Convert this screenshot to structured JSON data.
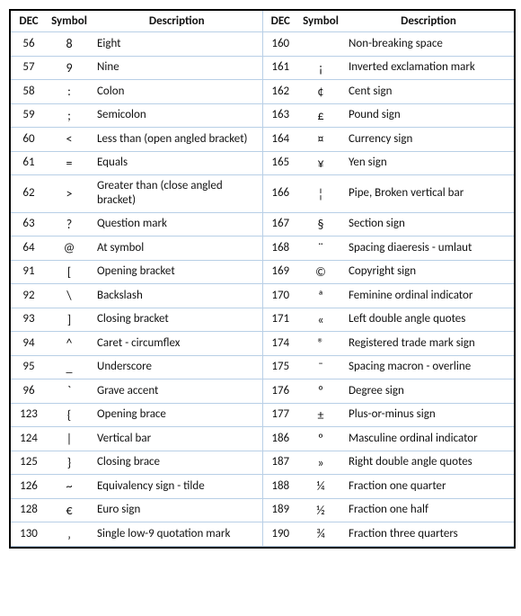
{
  "headers": {
    "dec": "DEC",
    "symbol": "Symbol",
    "description": "Description"
  },
  "rows": [
    {
      "l": {
        "dec": "56",
        "sym": "8",
        "desc": "Eight"
      },
      "r": {
        "dec": "160",
        "sym": "",
        "desc": "Non-breaking space"
      }
    },
    {
      "l": {
        "dec": "57",
        "sym": "9",
        "desc": "Nine"
      },
      "r": {
        "dec": "161",
        "sym": "¡",
        "desc": "Inverted exclamation mark"
      }
    },
    {
      "l": {
        "dec": "58",
        "sym": ":",
        "desc": "Colon"
      },
      "r": {
        "dec": "162",
        "sym": "¢",
        "desc": "Cent sign"
      }
    },
    {
      "l": {
        "dec": "59",
        "sym": ";",
        "desc": "Semicolon"
      },
      "r": {
        "dec": "163",
        "sym": "£",
        "desc": "Pound sign"
      }
    },
    {
      "l": {
        "dec": "60",
        "sym": "<",
        "desc": "Less than (open angled bracket)"
      },
      "r": {
        "dec": "164",
        "sym": "¤",
        "desc": "Currency sign"
      }
    },
    {
      "l": {
        "dec": "61",
        "sym": "=",
        "desc": "Equals"
      },
      "r": {
        "dec": "165",
        "sym": "¥",
        "desc": "Yen sign"
      }
    },
    {
      "l": {
        "dec": "62",
        "sym": ">",
        "desc": "Greater than (close angled bracket)"
      },
      "r": {
        "dec": "166",
        "sym": "¦",
        "desc": "Pipe, Broken vertical bar"
      }
    },
    {
      "l": {
        "dec": "63",
        "sym": "?",
        "desc": "Question mark"
      },
      "r": {
        "dec": "167",
        "sym": "§",
        "desc": "Section sign"
      }
    },
    {
      "l": {
        "dec": "64",
        "sym": "@",
        "desc": "At symbol"
      },
      "r": {
        "dec": "168",
        "sym": "¨",
        "desc": "Spacing diaeresis - umlaut"
      }
    },
    {
      "l": {
        "dec": "91",
        "sym": "[",
        "desc": "Opening bracket"
      },
      "r": {
        "dec": "169",
        "sym": "©",
        "desc": "Copyright sign"
      }
    },
    {
      "l": {
        "dec": "92",
        "sym": "\\",
        "desc": "Backslash"
      },
      "r": {
        "dec": "170",
        "sym": "ª",
        "desc": "Feminine ordinal indicator"
      }
    },
    {
      "l": {
        "dec": "93",
        "sym": "]",
        "desc": "Closing bracket"
      },
      "r": {
        "dec": "171",
        "sym": "«",
        "desc": "Left double angle quotes"
      }
    },
    {
      "l": {
        "dec": "94",
        "sym": "^",
        "desc": "Caret - circumflex"
      },
      "r": {
        "dec": "174",
        "sym": "®",
        "desc": "Registered trade mark sign"
      }
    },
    {
      "l": {
        "dec": "95",
        "sym": "_",
        "desc": "Underscore"
      },
      "r": {
        "dec": "175",
        "sym": "¯",
        "desc": "Spacing macron - overline"
      }
    },
    {
      "l": {
        "dec": "96",
        "sym": "`",
        "desc": "Grave accent"
      },
      "r": {
        "dec": "176",
        "sym": "°",
        "desc": "Degree sign"
      }
    },
    {
      "l": {
        "dec": "123",
        "sym": "{",
        "desc": "Opening brace"
      },
      "r": {
        "dec": "177",
        "sym": "±",
        "desc": "Plus-or-minus sign"
      }
    },
    {
      "l": {
        "dec": "124",
        "sym": "|",
        "desc": "Vertical bar"
      },
      "r": {
        "dec": "186",
        "sym": "º",
        "desc": "Masculine ordinal indicator"
      }
    },
    {
      "l": {
        "dec": "125",
        "sym": "}",
        "desc": "Closing brace"
      },
      "r": {
        "dec": "187",
        "sym": "»",
        "desc": "Right double angle quotes"
      }
    },
    {
      "l": {
        "dec": "126",
        "sym": "~",
        "desc": "Equivalency sign - tilde"
      },
      "r": {
        "dec": "188",
        "sym": "¼",
        "desc": "Fraction one quarter"
      }
    },
    {
      "l": {
        "dec": "128",
        "sym": "€",
        "desc": "Euro sign"
      },
      "r": {
        "dec": "189",
        "sym": "½",
        "desc": "Fraction one half"
      }
    },
    {
      "l": {
        "dec": "130",
        "sym": "‚",
        "desc": "Single low-9 quotation mark"
      },
      "r": {
        "dec": "190",
        "sym": "¾",
        "desc": "Fraction three quarters"
      }
    }
  ]
}
